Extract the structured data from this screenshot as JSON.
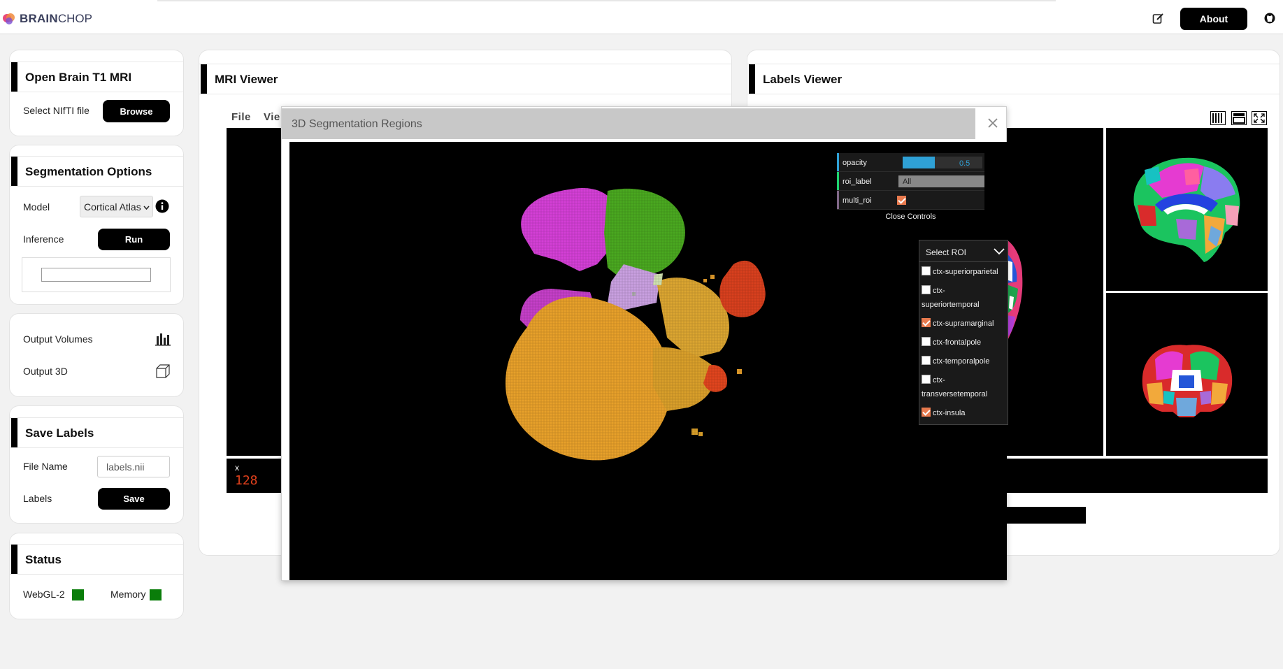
{
  "app": {
    "brand_bold": "BRAIN",
    "brand_light": "CHOP",
    "about_label": "About"
  },
  "sidebar": {
    "open_mri": {
      "title": "Open Brain T1 MRI",
      "select_label": "Select NIfTI file",
      "browse_label": "Browse"
    },
    "segmentation": {
      "title": "Segmentation Options",
      "model_label": "Model",
      "model_value": "Cortical Atlas",
      "inference_label": "Inference",
      "run_label": "Run",
      "progress": 0
    },
    "output": {
      "volumes_label": "Output Volumes",
      "output3d_label": "Output 3D"
    },
    "save_labels": {
      "title": "Save Labels",
      "file_name_label": "File Name",
      "file_name_value": "labels.nii",
      "labels_label": "Labels",
      "save_label": "Save"
    },
    "status": {
      "title": "Status",
      "webgl_label": "WebGL-2",
      "memory_label": "Memory",
      "ok_color": "#0a7d0a"
    }
  },
  "mri_viewer": {
    "title": "MRI Viewer",
    "menu_file": "File",
    "menu_view": "Vie",
    "coord_axis": "x",
    "coord_value": "128",
    "coord_color": "#e0401c"
  },
  "labels_viewer": {
    "title": "Labels Viewer"
  },
  "modal": {
    "title": "3D Segmentation Regions",
    "gui": {
      "opacity_label": "opacity",
      "opacity_value": "0.5",
      "opacity_fraction": 0.5,
      "roi_label_label": "roi_label",
      "roi_label_value": "All",
      "multi_roi_label": "multi_roi",
      "multi_roi_checked": true,
      "close_controls": "Close Controls",
      "accent_color": "#2fa1d6"
    },
    "roi": {
      "header": "Select ROI",
      "items": [
        {
          "label": "ctx-superiorparietal",
          "checked": false
        },
        {
          "label": "ctx-superiortemporal",
          "checked": false
        },
        {
          "label": "ctx-supramarginal",
          "checked": true
        },
        {
          "label": "ctx-frontalpole",
          "checked": false
        },
        {
          "label": "ctx-temporalpole",
          "checked": false
        },
        {
          "label": "ctx-transversetemporal",
          "checked": false
        },
        {
          "label": "ctx-insula",
          "checked": true
        }
      ]
    }
  }
}
